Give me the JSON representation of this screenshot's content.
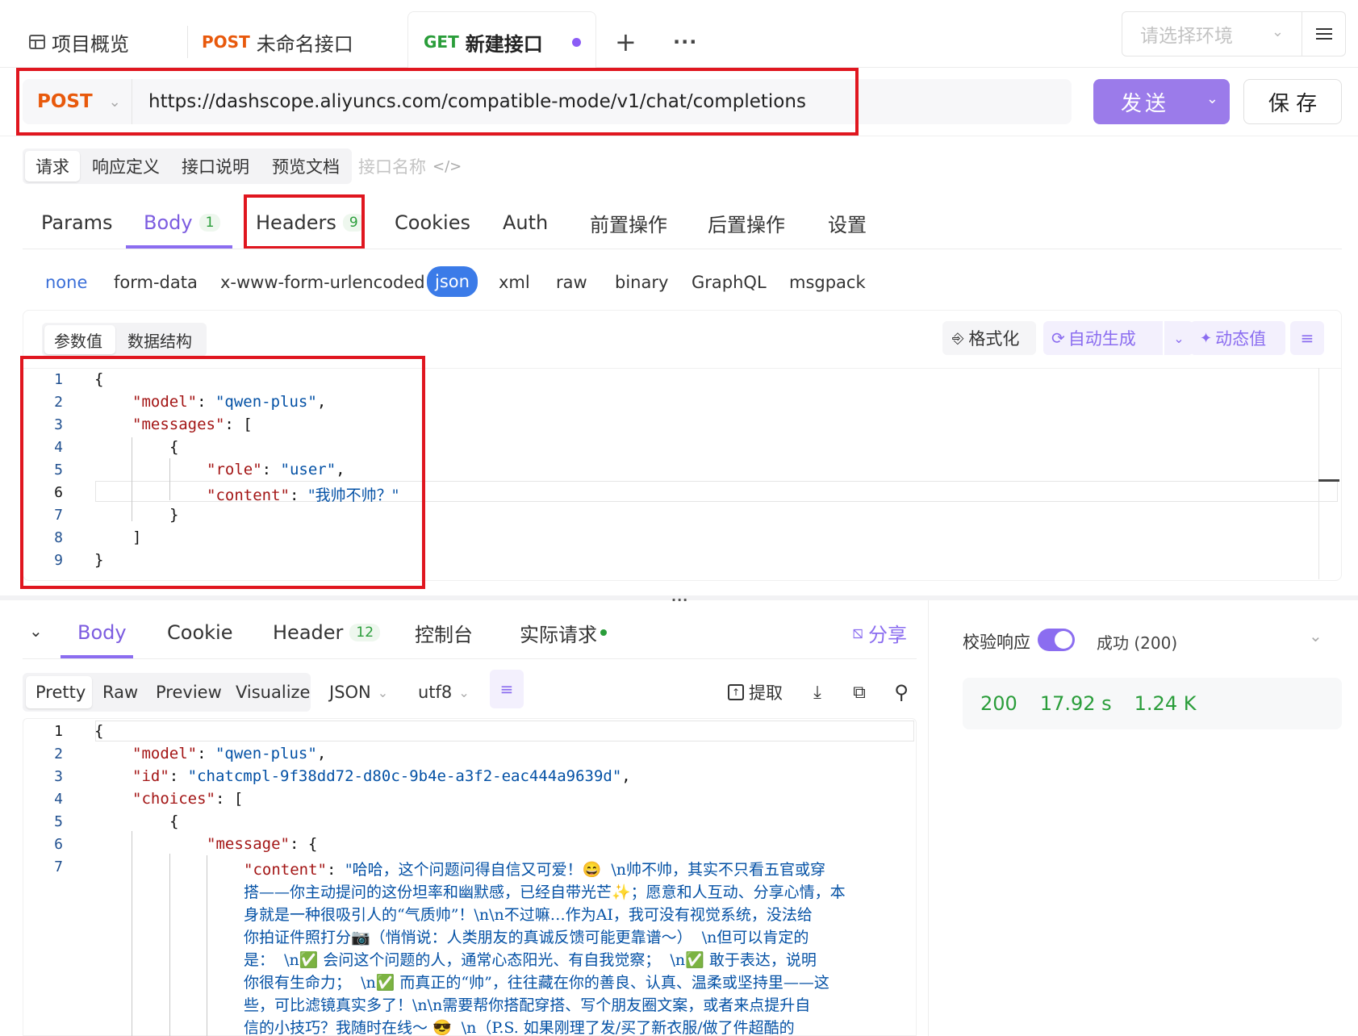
{
  "tabs": {
    "overview_label": "项目概览",
    "tab1": {
      "method": "POST",
      "name": "未命名接口"
    },
    "tab2": {
      "method": "GET",
      "name": "新建接口"
    },
    "add_label": "+",
    "more_label": "···",
    "env_placeholder": "请选择环境"
  },
  "request": {
    "method": "POST",
    "url": "https://dashscope.aliyuncs.com/compatible-mode/v1/chat/completions",
    "send_label": "发送",
    "save_label": "保 存"
  },
  "segments": {
    "items": [
      "请求",
      "响应定义",
      "接口说明",
      "预览文档"
    ],
    "name_placeholder": "接口名称"
  },
  "req_tabs": [
    {
      "label": "Params"
    },
    {
      "label": "Body",
      "badge": "1"
    },
    {
      "label": "Headers",
      "badge": "9"
    },
    {
      "label": "Cookies"
    },
    {
      "label": "Auth"
    },
    {
      "label": "前置操作"
    },
    {
      "label": "后置操作"
    },
    {
      "label": "设置"
    }
  ],
  "body_types": [
    "none",
    "form-data",
    "x-www-form-urlencoded",
    "json",
    "xml",
    "raw",
    "binary",
    "GraphQL",
    "msgpack"
  ],
  "editor_toolbar": {
    "mode1": "参数值",
    "mode2": "数据结构",
    "format_label": "格式化",
    "auto_label": "自动生成",
    "dynamic_label": "动态值"
  },
  "request_body_lines": [
    "1",
    "2",
    "3",
    "4",
    "5",
    "6",
    "7",
    "8",
    "9"
  ],
  "request_body": {
    "l1": "{",
    "model_key": "\"model\"",
    "model_val": "\"qwen-plus\"",
    "messages_key": "\"messages\"",
    "l4": "{",
    "role_key": "\"role\"",
    "role_val": "\"user\"",
    "content_key": "\"content\"",
    "content_val": "\"我帅不帅？\"",
    "l7": "}",
    "l8": "]",
    "l9": "}"
  },
  "response_tabs": [
    {
      "label": "Body"
    },
    {
      "label": "Cookie"
    },
    {
      "label": "Header",
      "badge": "12"
    },
    {
      "label": "控制台"
    },
    {
      "label": "实际请求"
    }
  ],
  "share_label": "分享",
  "view_tabs": [
    "Pretty",
    "Raw",
    "Preview",
    "Visualize"
  ],
  "format_select": "JSON",
  "encoding_select": "utf8",
  "extract_label": "提取",
  "validate": {
    "label": "校验响应",
    "status_text": "成功 (200)"
  },
  "stats": {
    "code": "200",
    "time": "17.92 s",
    "size": "1.24 K"
  },
  "response_lines": [
    "1",
    "2",
    "3",
    "4",
    "5",
    "6",
    "7"
  ],
  "response_body": {
    "l1": "{",
    "model_key": "\"model\"",
    "model_val": "\"qwen-plus\"",
    "id_key": "\"id\"",
    "id_val": "\"chatcmpl-9f38dd72-d80c-9b4e-a3f2-eac444a9639d\"",
    "choices_key": "\"choices\"",
    "l5": "{",
    "message_key": "\"message\"",
    "content_key": "\"content\"",
    "content_lines": [
      "\"哈哈，这个问题问得自信又可爱！😄  \\n帅不帅，其实不只看五官或穿",
      "搭——你主动提问的这份坦率和幽默感，已经自带光芒✨；愿意和人互动、分享心情，本",
      "身就是一种很吸引人的“气质帅”！\\n\\n不过嘛…作为AI，我可没有视觉系统，没法给",
      "你拍证件照打分📷（悄悄说：人类朋友的真诚反馈可能更靠谱～）  \\n但可以肯定的",
      "是：  \\n✅ 会问这个问题的人，通常心态阳光、有自我觉察；  \\n✅ 敢于表达，说明",
      "你很有生命力；  \\n✅ 而真正的“帅”，往往藏在你的善良、认真、温柔或坚持里——这",
      "些，可比滤镜真实多了！\\n\\n需要帮你搭配穿搭、写个朋友圈文案，或者来点提升自",
      "信的小技巧？我随时在线～ 😎  \\n（P.S. 如果刚理了发/买了新衣服/做了件超酷的"
    ]
  }
}
